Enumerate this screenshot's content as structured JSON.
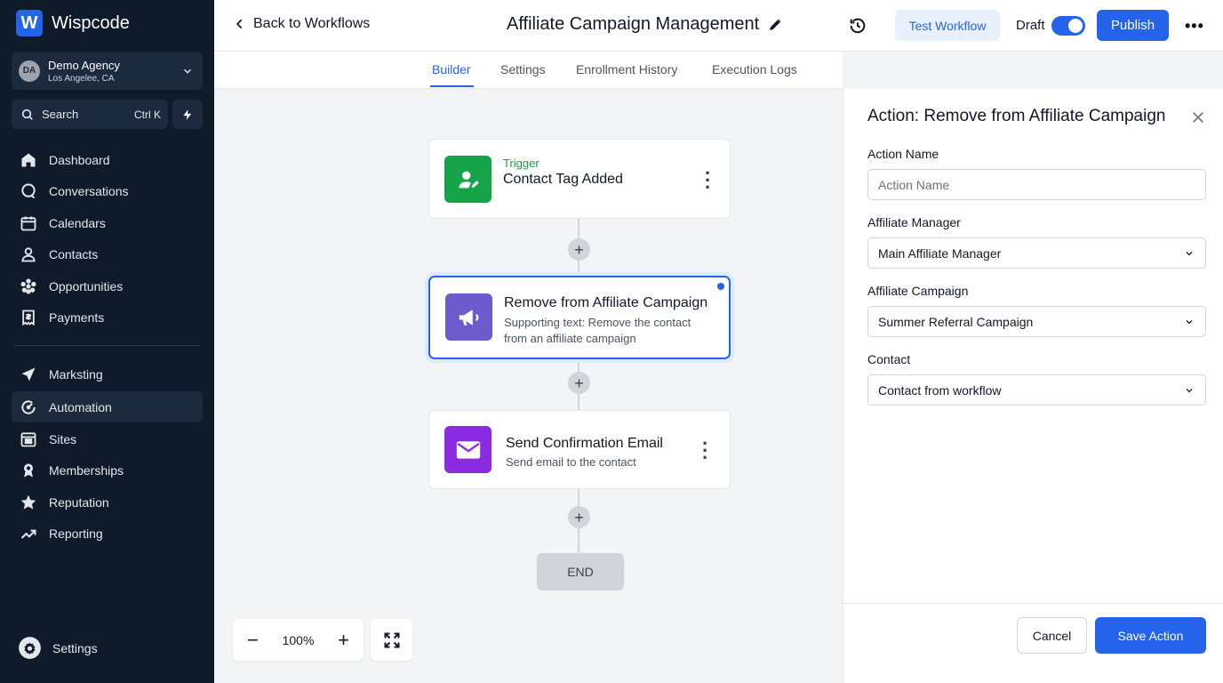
{
  "brand": {
    "logo_letter": "W",
    "name": "Wispcode"
  },
  "agency": {
    "initials": "DA",
    "name": "Demo Agency",
    "location": "Los Angelee, CA"
  },
  "search": {
    "label": "Search",
    "shortcut": "Ctrl K"
  },
  "nav": {
    "items": [
      {
        "label": "Dashboard",
        "icon": "home-icon"
      },
      {
        "label": "Conversations",
        "icon": "chat-icon"
      },
      {
        "label": "Calendars",
        "icon": "calendar-icon"
      },
      {
        "label": "Contacts",
        "icon": "user-icon"
      },
      {
        "label": "Opportunities",
        "icon": "asterisk-icon"
      },
      {
        "label": "Payments",
        "icon": "receipt-icon"
      },
      {
        "label": "Marksting",
        "icon": "send-icon"
      },
      {
        "label": "Automation",
        "icon": "automation-icon",
        "active": true
      },
      {
        "label": "Sites",
        "icon": "browser-icon"
      },
      {
        "label": "Memberships",
        "icon": "badge-icon"
      },
      {
        "label": "Reputation",
        "icon": "star-icon"
      },
      {
        "label": "Reporting",
        "icon": "trend-icon"
      }
    ],
    "settings_label": "Settings"
  },
  "header": {
    "back_label": "Back to Workflows",
    "title": "Affiliate Campaign Management",
    "test_label": "Test Workflow",
    "draft_label": "Draft",
    "publish_label": "Publish",
    "more_label": "•••"
  },
  "tabs": [
    {
      "label": "Builder",
      "active": true
    },
    {
      "label": "Settings"
    },
    {
      "label": "Enrollment History"
    },
    {
      "label": "Execution Logs"
    }
  ],
  "workflow": {
    "trigger": {
      "kicker": "Trigger",
      "title": "Contact Tag Added"
    },
    "action1": {
      "title": "Remove from Affiliate Campaign",
      "subtitle": "Supporting text: Remove the contact from an affiliate campaign"
    },
    "action2": {
      "title": "Send Confirmation Email",
      "subtitle": "Send email to the contact"
    },
    "end_label": "END",
    "plus": "+"
  },
  "zoom": {
    "minus": "−",
    "level": "100%",
    "plus": "+"
  },
  "panel": {
    "title": "Action: Remove from Affiliate Campaign",
    "fields": {
      "action_name": {
        "label": "Action Name",
        "placeholder": "Action Name",
        "value": ""
      },
      "manager": {
        "label": "Affiliate Manager",
        "value": "Main Affiliate Manager"
      },
      "campaign": {
        "label": "Affiliate Campaign",
        "value": "Summer Referral Campaign"
      },
      "contact": {
        "label": "Contact",
        "value": "Contact from workflow"
      }
    },
    "cancel_label": "Cancel",
    "save_label": "Save Action"
  },
  "colors": {
    "accent": "#2563eb",
    "sidebar": "#0f1a2a",
    "trigger": "#16a34a",
    "action": "#6d5acd",
    "email": "#8a2be2"
  }
}
